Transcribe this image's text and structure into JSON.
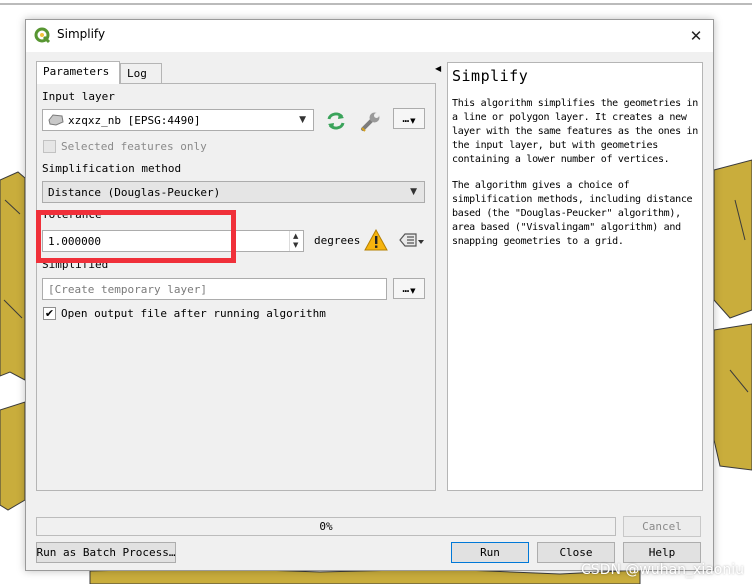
{
  "window": {
    "title": "Simplify"
  },
  "tabs": [
    {
      "label": "Parameters",
      "active": true
    },
    {
      "label": "Log",
      "active": false
    }
  ],
  "params": {
    "input_layer_label": "Input layer",
    "input_layer_value": "xzqxz_nb [EPSG:4490]",
    "selected_only_label": "Selected features only",
    "selected_only_checked": false,
    "method_label": "Simplification method",
    "method_value": "Distance (Douglas-Peucker)",
    "tolerance_label": "Tolerance",
    "tolerance_value": "1.000000",
    "tolerance_unit": "degrees",
    "output_label": "Simplified",
    "output_placeholder": "[Create temporary layer]",
    "open_after_label": "Open output file after running algorithm",
    "open_after_checked": true,
    "more_button": "…"
  },
  "help": {
    "title": "Simplify",
    "p1": "This algorithm simplifies the geometries in a line or polygon layer. It creates a new layer with the same features as the ones in the input layer, but with geometries containing a lower number of vertices.",
    "p2": "The algorithm gives a choice of simplification methods, including distance based (the \"Douglas-Peucker\" algorithm), area based (\"Visvalingam\" algorithm) and snapping geometries to a grid."
  },
  "progress": {
    "value": 0,
    "text": "0%"
  },
  "buttons": {
    "cancel": "Cancel",
    "batch": "Run as Batch Process…",
    "run": "Run",
    "close": "Close",
    "help": "Help"
  },
  "watermark": "CSDN @wuhan_xiaoniu",
  "colors": {
    "highlight": "#f0303a",
    "map_fill": "#c9ad3c",
    "qgis_green": "#589632"
  }
}
